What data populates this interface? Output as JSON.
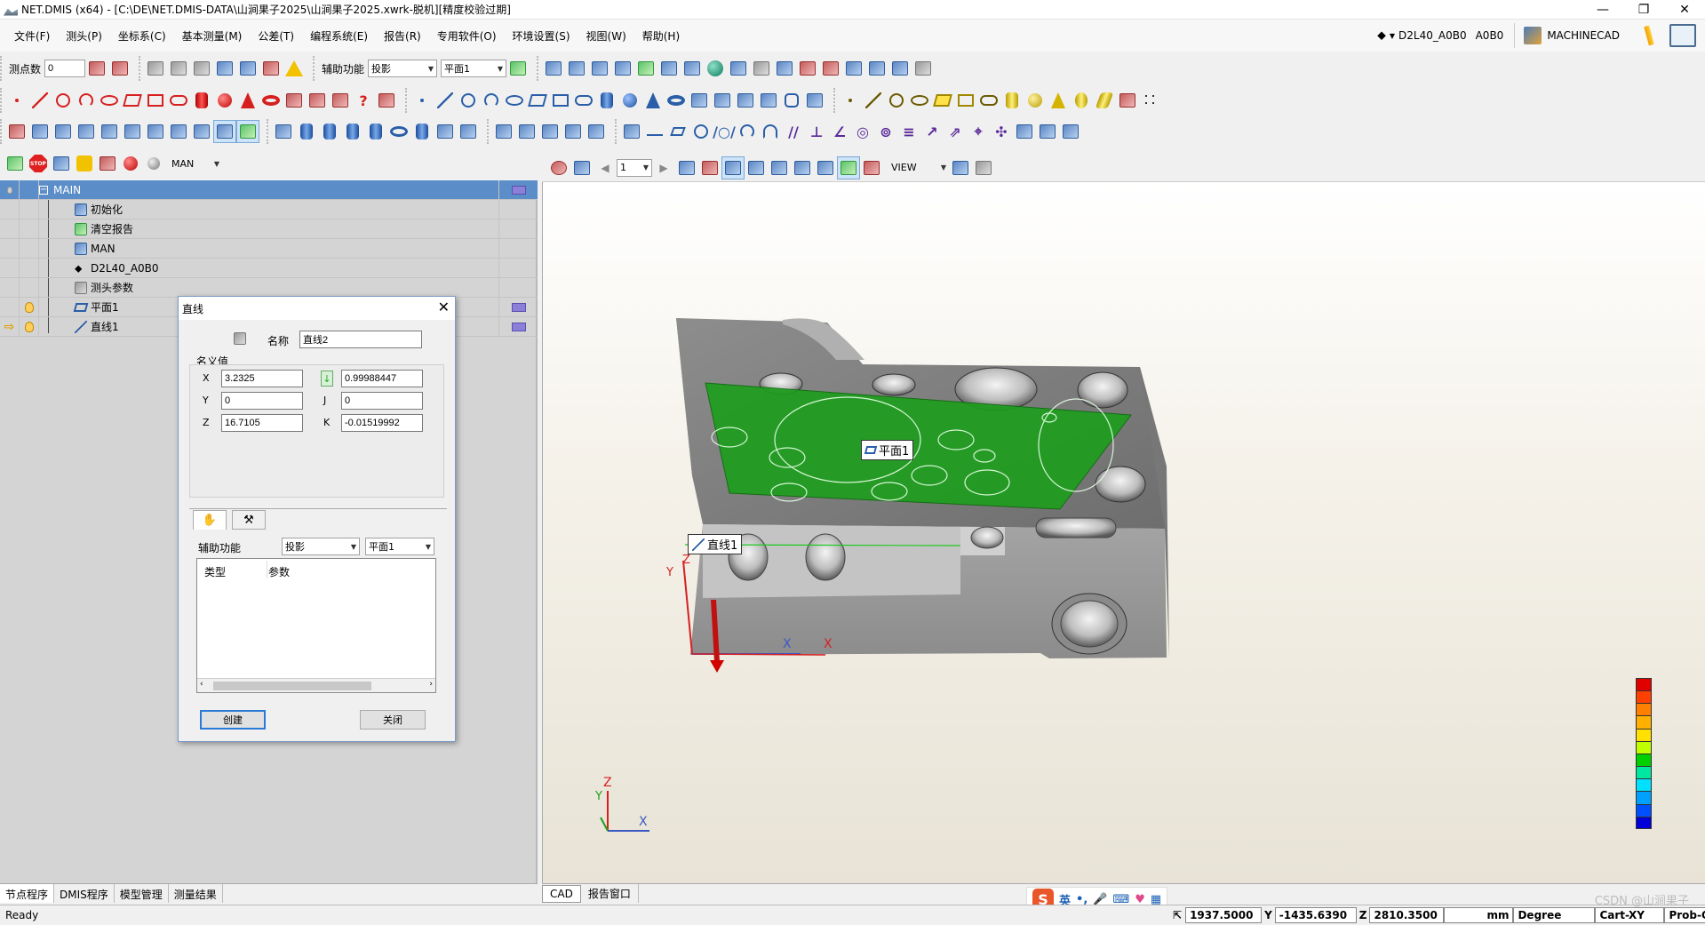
{
  "window": {
    "title": "NET.DMIS (x64) - [C:\\DE\\NET.DMIS-DATA\\山涧果子2025\\山涧果子2025.xwrk-脱机][精度校验过期]",
    "controls": [
      "minimize",
      "restore",
      "close"
    ]
  },
  "menu": {
    "items": [
      "文件(F)",
      "测头(P)",
      "坐标系(C)",
      "基本测量(M)",
      "公差(T)",
      "编程系统(E)",
      "报告(R)",
      "专用软件(O)",
      "环境设置(S)",
      "视图(W)",
      "帮助(H)"
    ],
    "probe": "D2L40_A0B0",
    "machine": "MACHINECAD"
  },
  "toolbar1": {
    "points_label": "测点数",
    "points_value": "0",
    "aux_label": "辅助功能",
    "aux_value": "投影",
    "plane_value": "平面1"
  },
  "toolbar4": {
    "mode_value": "MAN"
  },
  "tree": {
    "rows": [
      {
        "label": "MAIN",
        "type": "header"
      },
      {
        "label": "初始化"
      },
      {
        "label": "清空报告"
      },
      {
        "label": "MAN"
      },
      {
        "label": "D2L40_A0B0"
      },
      {
        "label": "测头参数"
      },
      {
        "label": "平面1"
      },
      {
        "label": "直线1"
      }
    ]
  },
  "left_tabs": [
    "节点程序",
    "DMIS程序",
    "模型管理",
    "测量结果"
  ],
  "dialog": {
    "title": "直线",
    "name_label": "名称",
    "name_value": "直线2",
    "nominal_label": "名义值",
    "x_label": "X",
    "x_value": "3.2325",
    "y_label": "Y",
    "y_value": "0",
    "z_label": "Z",
    "z_value": "16.7105",
    "i_value": "0.99988447",
    "j_label": "J",
    "j_value": "0",
    "k_label": "K",
    "k_value": "-0.01519992",
    "aux_label": "辅助功能",
    "aux_value": "投影",
    "plane_value": "平面1",
    "col_type": "类型",
    "col_param": "参数",
    "create_btn": "创建",
    "close_btn": "关闭"
  },
  "viewport_toolbar": {
    "page_value": "1",
    "view_value": "VIEW"
  },
  "viewport": {
    "plane_label": "平面1",
    "line_label": "直线1",
    "axis_x": "X",
    "axis_y": "Y",
    "axis_z": "Z",
    "colors": {
      "plane": "#1e9e1e",
      "part": "#8a8a8a"
    }
  },
  "viewport_tabs": [
    "CAD",
    "报告窗口"
  ],
  "status": {
    "ready": "Ready",
    "x_value": "1937.5000",
    "y_label": "Y",
    "y_value": "-1435.6390",
    "z_label": "Z",
    "z_value": "2810.3500",
    "unit": "mm",
    "angle": "Degree",
    "plane": "Cart-XY",
    "probe_mode": "Prob-On",
    "watermark": "CSDN @山涧果子"
  },
  "ime": {
    "logo": "S",
    "lang": "英"
  }
}
